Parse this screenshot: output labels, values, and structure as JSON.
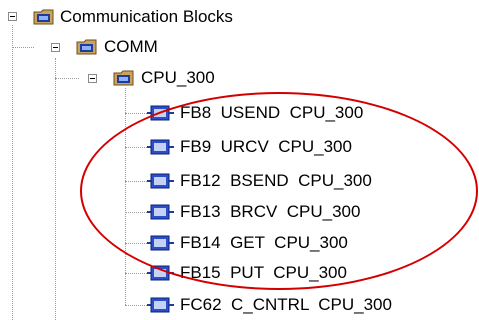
{
  "tree": {
    "root": {
      "label": "Communication Blocks",
      "expanded": true
    },
    "comm": {
      "label": "COMM",
      "expanded": true
    },
    "cpu": {
      "label": "CPU_300",
      "expanded": true
    },
    "blocks": [
      {
        "label": "FB8  USEND  CPU_300"
      },
      {
        "label": "FB9  URCV  CPU_300"
      },
      {
        "label": "FB12  BSEND  CPU_300"
      },
      {
        "label": "FB13  BRCV  CPU_300"
      },
      {
        "label": "FB14  GET  CPU_300"
      },
      {
        "label": "FB15  PUT  CPU_300"
      },
      {
        "label": "FC62  C_CNTRL  CPU_300"
      }
    ]
  },
  "annotation": {
    "color": "#d40000"
  }
}
